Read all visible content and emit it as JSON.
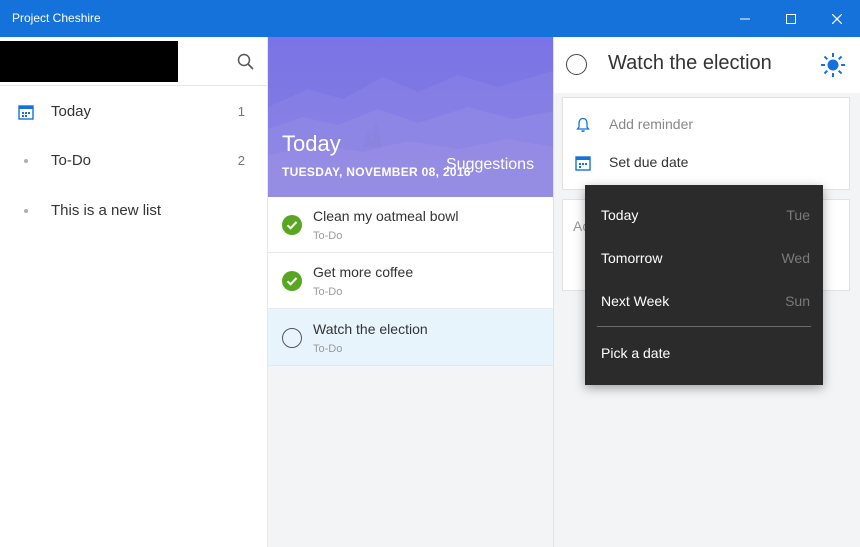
{
  "window": {
    "title": "Project Cheshire",
    "controls": [
      "minimize-icon",
      "maximize-icon",
      "close-icon"
    ],
    "accent_color": "#1672db"
  },
  "sidebar": {
    "search_icon": "search-icon",
    "items": [
      {
        "label": "Today",
        "count": "1",
        "icon": "calendar-icon"
      },
      {
        "label": "To-Do",
        "count": "2",
        "icon": "dot"
      },
      {
        "label": "This is a new list",
        "count": "",
        "icon": "dot"
      }
    ]
  },
  "list": {
    "title": "Today",
    "date": "TUESDAY, NOVEMBER 08, 2016",
    "suggestions_label": "Suggestions",
    "tasks": [
      {
        "title": "Clean my oatmeal bowl",
        "list": "To-Do",
        "completed": true
      },
      {
        "title": "Get more coffee",
        "list": "To-Do",
        "completed": true
      },
      {
        "title": "Watch the election",
        "list": "To-Do",
        "completed": false,
        "selected": true
      }
    ]
  },
  "detail": {
    "task_title": "Watch the election",
    "add_reminder_label": "Add reminder",
    "set_due_date_label": "Set due date",
    "note_placeholder": "Ac"
  },
  "due_date_menu": {
    "options": [
      {
        "label": "Today",
        "day": "Tue"
      },
      {
        "label": "Tomorrow",
        "day": "Wed"
      },
      {
        "label": "Next Week",
        "day": "Sun"
      }
    ],
    "pick_date_label": "Pick a date"
  },
  "colors": {
    "check_done": "#59a622",
    "banner": "#7b74e6",
    "selected_row": "#e8f4fc",
    "menu_bg": "#2b2b2b",
    "link_blue": "#1672db"
  }
}
